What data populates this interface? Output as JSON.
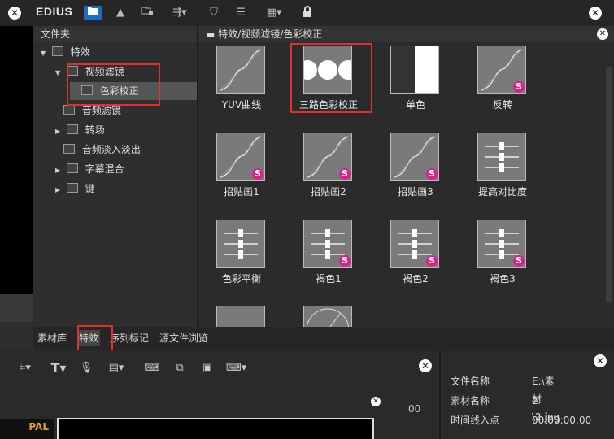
{
  "app": {
    "logo": "EDIUS"
  },
  "tree": {
    "header": "文件夹",
    "items": [
      {
        "label": "特效"
      },
      {
        "label": "视频滤镜"
      },
      {
        "label": "色彩校正"
      },
      {
        "label": "音频滤镜"
      },
      {
        "label": "转场"
      },
      {
        "label": "音频淡入淡出"
      },
      {
        "label": "字幕混合"
      },
      {
        "label": "键"
      }
    ]
  },
  "fx": {
    "breadcrumb": "特效/视频滤镜/色彩校正",
    "tiles": [
      {
        "label": "YUV曲线"
      },
      {
        "label": "三路色彩校正"
      },
      {
        "label": "单色"
      },
      {
        "label": "反转"
      },
      {
        "label": "招贴画1"
      },
      {
        "label": "招贴画2"
      },
      {
        "label": "招贴画3"
      },
      {
        "label": "提高对比度"
      },
      {
        "label": "色彩平衡"
      },
      {
        "label": "褐色1"
      },
      {
        "label": "褐色2"
      },
      {
        "label": "褐色3"
      }
    ],
    "badge": "S"
  },
  "tabs": [
    {
      "label": "素材库"
    },
    {
      "label": "特效"
    },
    {
      "label": "序列标记"
    },
    {
      "label": "源文件浏览"
    }
  ],
  "info": {
    "rows": [
      {
        "key": "文件名称",
        "value": "E:\\素材\\2.jpg"
      },
      {
        "key": "素材名称",
        "value": "2"
      },
      {
        "key": "时间线入点",
        "value": "00:00:00:00"
      }
    ]
  },
  "monitor": {
    "format": "PAL",
    "tick": "00"
  },
  "colors": {
    "accent": "#1e6cc2",
    "highlight": "#e03030",
    "badge": "#e0208a"
  }
}
